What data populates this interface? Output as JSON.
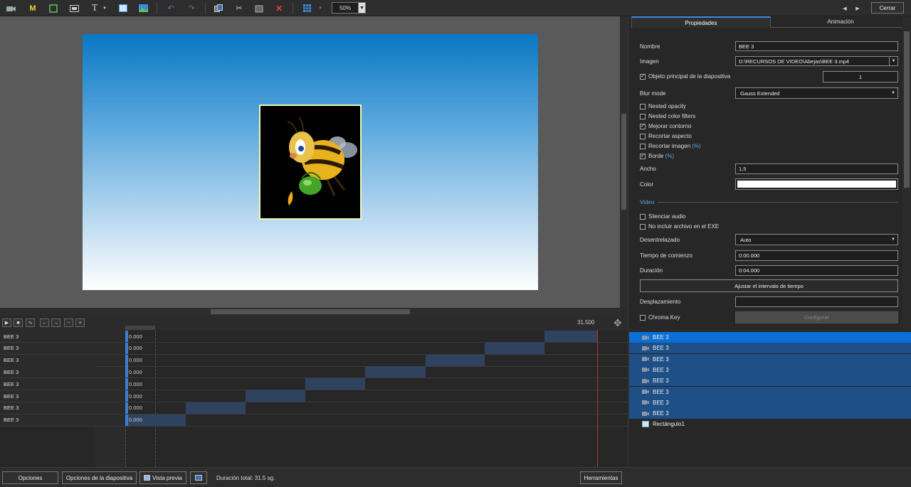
{
  "toolbar": {
    "zoom": "50%",
    "close_label": "Cerrar",
    "icons": [
      "camera-icon",
      "m-icon",
      "select-frame-icon",
      "text-box-icon",
      "text-icon",
      "rectangle-icon",
      "image-icon",
      "undo-icon",
      "redo-icon",
      "copy-icon",
      "cut-icon",
      "paste-icon",
      "delete-icon",
      "grid-icon"
    ]
  },
  "tabs": {
    "properties": "Propiedades",
    "animation": "Animación"
  },
  "properties": {
    "name_label": "Nombre",
    "name_value": "BEE 3",
    "image_label": "Imagen",
    "image_value": "D:\\RECURSOS DE VIDEO\\Abejas\\BEE 3.mp4",
    "main_object_label": "Objeto principal de la diapositiva",
    "main_object_value": "1",
    "blur_label": "Blur mode",
    "blur_value": "Gauss Extended",
    "nested_opacity": "Nested opacity",
    "nested_color": "Nested color filters",
    "mejorar": "Mejorar contorno",
    "recortar_aspecto": "Recortar aspecto",
    "recortar_imagen": "Recortar imagen",
    "borde": "Borde",
    "pct": "(%)",
    "ancho_label": "Ancho",
    "ancho_value": "1,5",
    "color_label": "Color",
    "color_value": "#ffffff",
    "video_section": "Video",
    "silenciar": "Silenciar audio",
    "no_incluir": "No incluir archivo en el EXE",
    "desentrelazado_label": "Desentrelazado",
    "desentrelazado_value": "Auto",
    "tiempo_label": "Tiempo de comienzo",
    "tiempo_value": "0:00.000",
    "duracion_label": "Duración",
    "duracion_value": "0:04.000",
    "ajustar_button": "Ajustar el intervalo de tiempo",
    "desplazamiento_label": "Desplazamiento",
    "desplazamiento_value": "",
    "chroma_label": "Chroma Key",
    "configurar_button": "Configurar"
  },
  "timeline": {
    "end_time": "31.500",
    "rows": [
      {
        "name": "BEE 3",
        "value": "0.000"
      },
      {
        "name": "BEE 3",
        "value": "0.000"
      },
      {
        "name": "BEE 3",
        "value": "0.000"
      },
      {
        "name": "BEE 3",
        "value": "0.000"
      },
      {
        "name": "BEE 3",
        "value": "0.000"
      },
      {
        "name": "BEE 3",
        "value": "0.000"
      },
      {
        "name": "BEE 3",
        "value": "0.000"
      },
      {
        "name": "BEE 3",
        "value": "0.000"
      }
    ]
  },
  "objects": [
    {
      "label": "BEE 3"
    },
    {
      "label": "BEE 3"
    },
    {
      "label": "BEE 3"
    },
    {
      "label": "BEE 3"
    },
    {
      "label": "BEE 3"
    },
    {
      "label": "BEE 3"
    },
    {
      "label": "BEE 3"
    },
    {
      "label": "BEE 3"
    },
    {
      "label": "Rectángulo1"
    }
  ],
  "bottom": {
    "opciones": "Opciones",
    "opciones_diapositiva": "Opciones de la diapositiva",
    "vista_previa": "Vista previa",
    "duracion_total": "Duración total: 31.5 sg.",
    "herramientas": "Herramientas"
  }
}
